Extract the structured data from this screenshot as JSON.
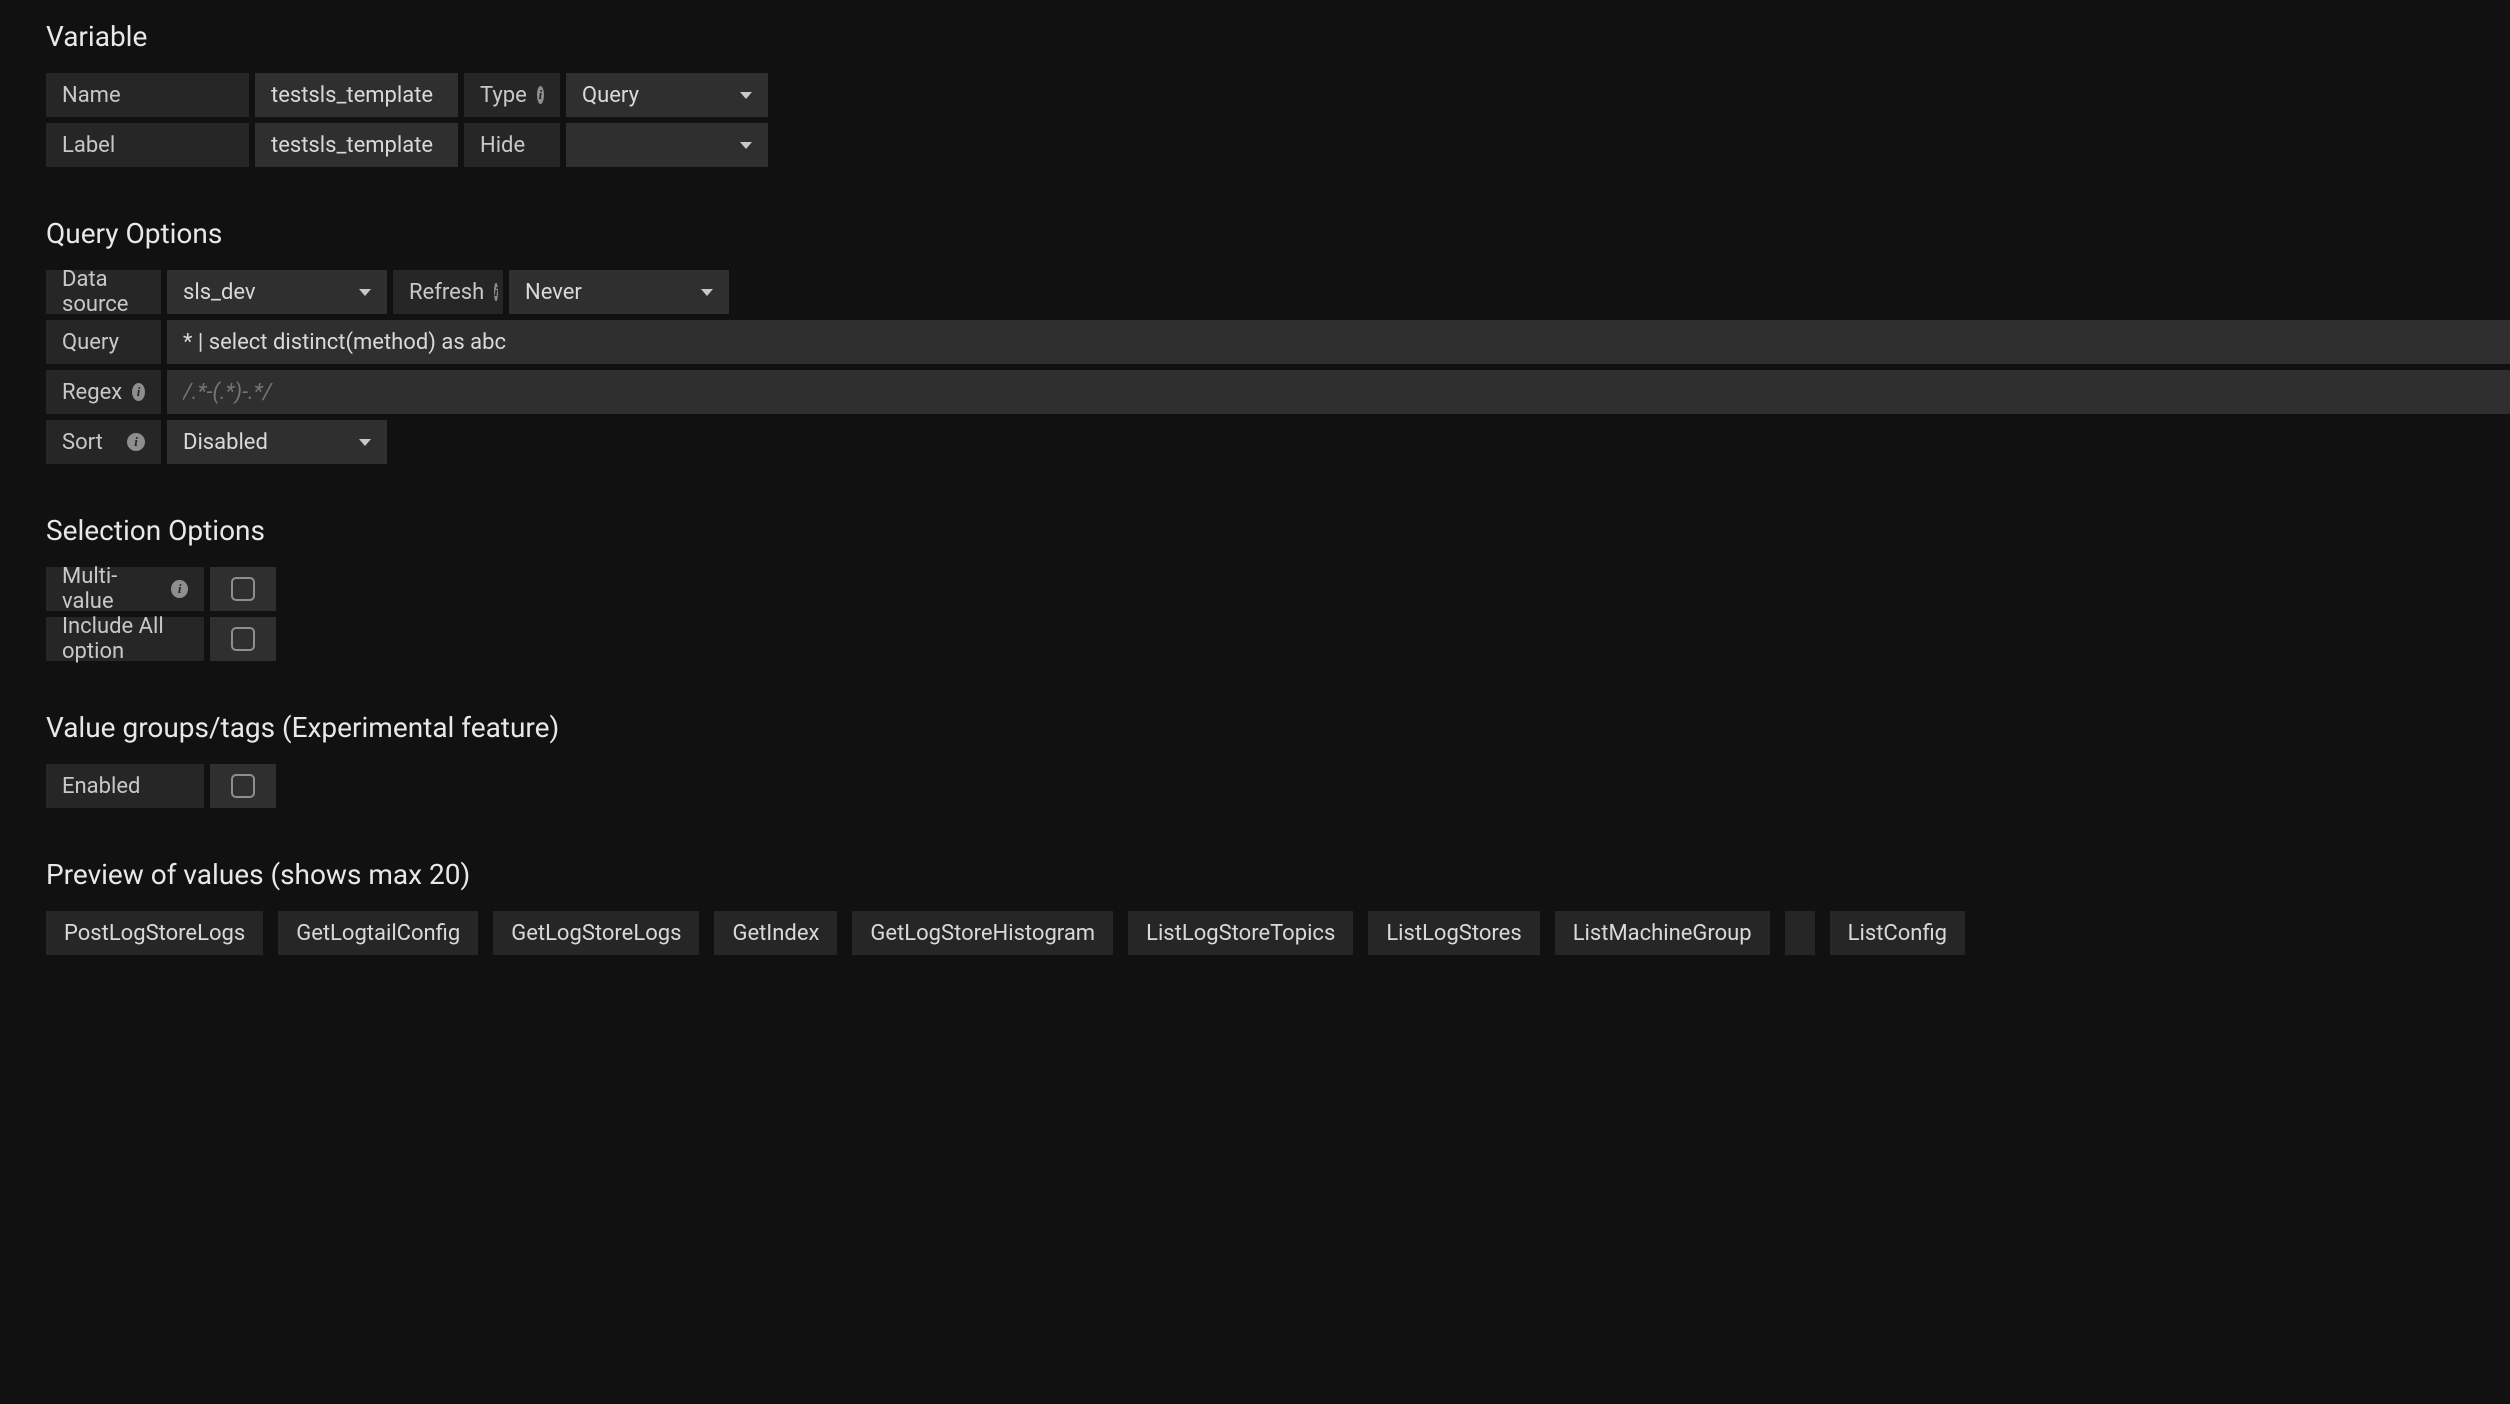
{
  "variable": {
    "heading": "Variable",
    "name_label": "Name",
    "name_value": "testsls_template",
    "type_label": "Type",
    "type_value": "Query",
    "label_label": "Label",
    "label_value": "testsls_template",
    "hide_label": "Hide",
    "hide_value": ""
  },
  "query_options": {
    "heading": "Query Options",
    "datasource_label": "Data source",
    "datasource_value": "sls_dev",
    "refresh_label": "Refresh",
    "refresh_value": "Never",
    "query_label": "Query",
    "query_value": "* | select distinct(method) as abc",
    "regex_label": "Regex",
    "regex_placeholder": "/.*-(.*)-.*/",
    "sort_label": "Sort",
    "sort_value": "Disabled"
  },
  "selection_options": {
    "heading": "Selection Options",
    "multi_label": "Multi-value",
    "include_all_label": "Include All option"
  },
  "value_groups": {
    "heading": "Value groups/tags (Experimental feature)",
    "enabled_label": "Enabled"
  },
  "preview": {
    "heading": "Preview of values (shows max 20)",
    "values": [
      "PostLogStoreLogs",
      "GetLogtailConfig",
      "GetLogStoreLogs",
      "GetIndex",
      "GetLogStoreHistogram",
      "ListLogStoreTopics",
      "ListLogStores",
      "ListMachineGroup",
      "ListConfig"
    ]
  }
}
